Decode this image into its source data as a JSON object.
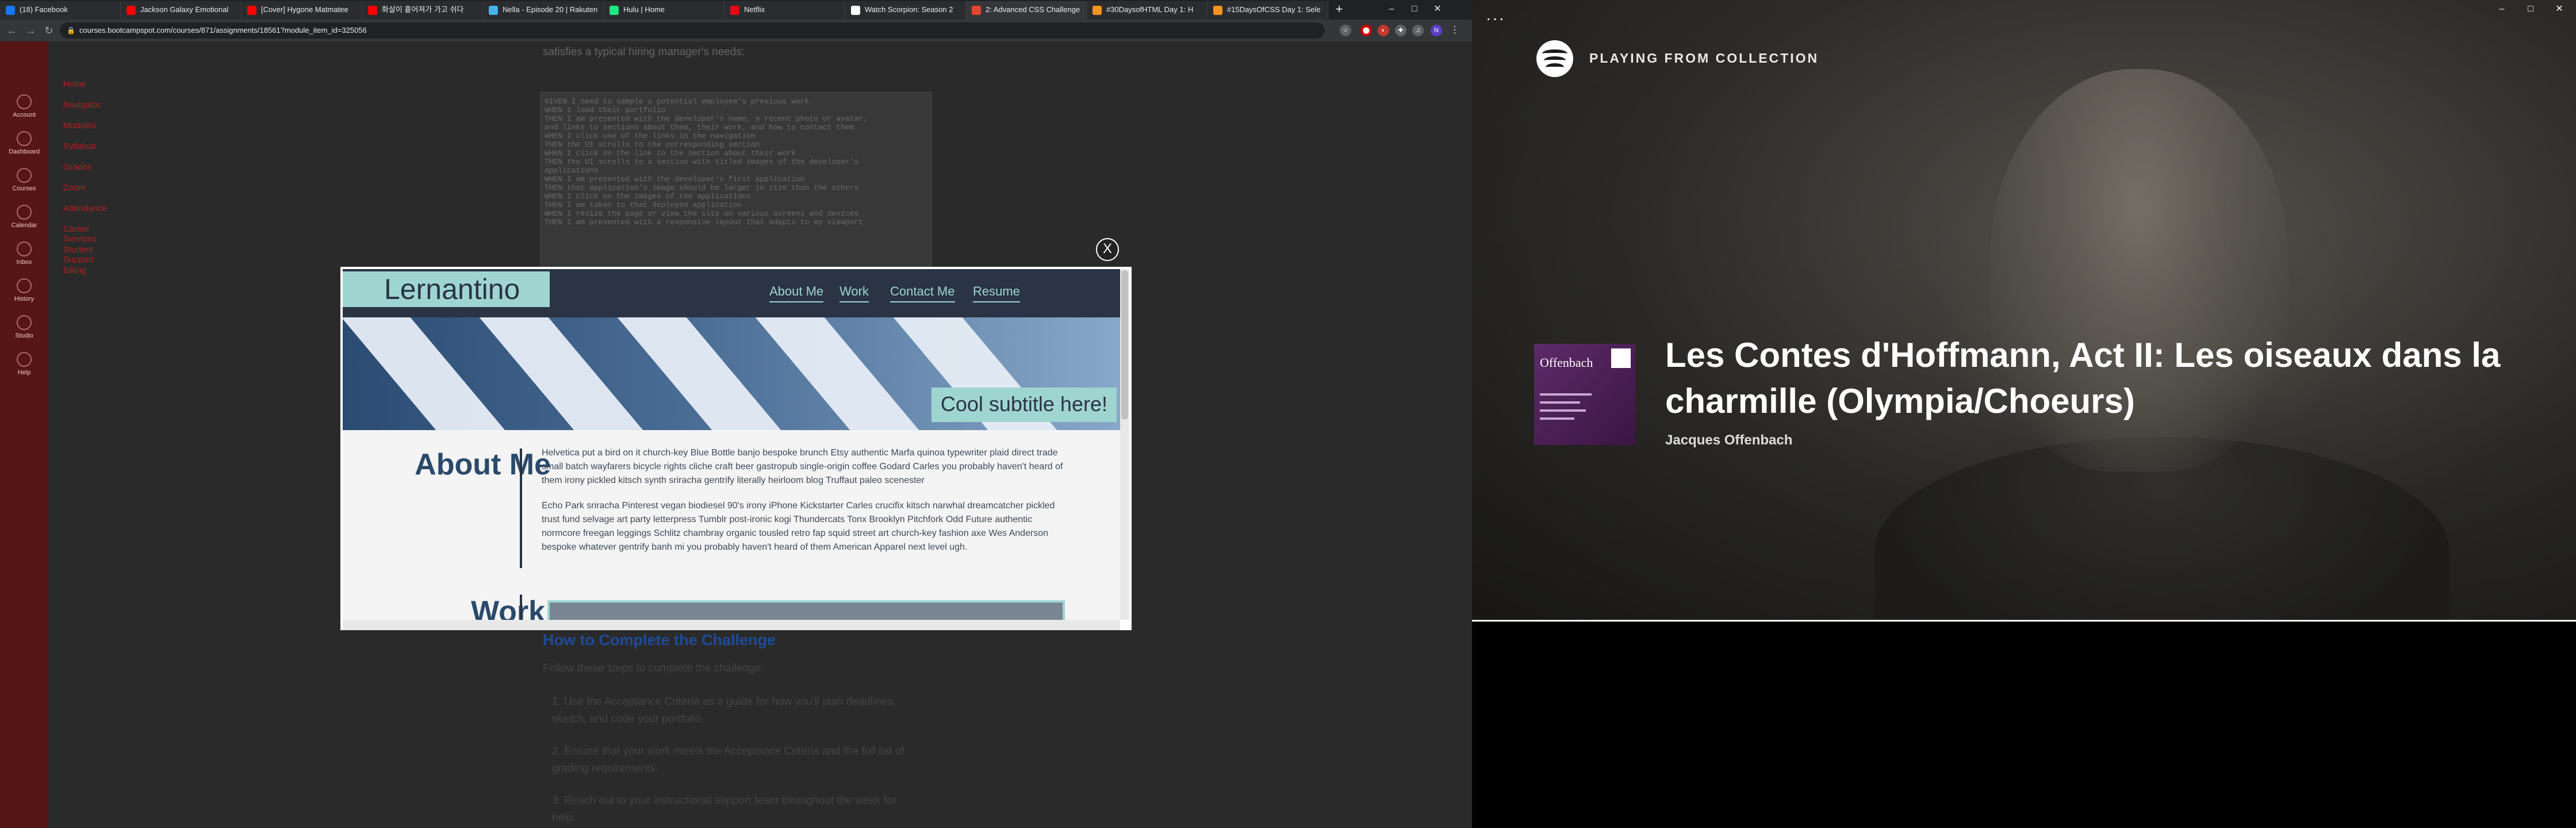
{
  "browser": {
    "tabs": [
      {
        "title": "(18) Facebook",
        "color": "#1877f2"
      },
      {
        "title": "Jackson Galaxy Emotional",
        "color": "#ff0000"
      },
      {
        "title": "[Cover] Hygone Matmatee",
        "color": "#ff0000"
      },
      {
        "title": "화살이 흩어져가 가고 쉬다",
        "color": "#ff0000"
      },
      {
        "title": "Nella - Episode 20 | Rakuten",
        "color": "#46b4e8"
      },
      {
        "title": "Hulu | Home",
        "color": "#1ce783"
      },
      {
        "title": "Netflix",
        "color": "#e50914"
      },
      {
        "title": "Watch Scorpion: Season 2",
        "color": "#ffffff"
      },
      {
        "title": "2: Advanced CSS Challenge",
        "color": "#e1462e"
      },
      {
        "title": "#30DaysofHTML Day 1: H",
        "color": "#f7931e"
      },
      {
        "title": "#15DaysOfCSS Day 1: Sele",
        "color": "#f7931e"
      }
    ],
    "new_tab": "+",
    "url": "courses.bootcampspot.com/courses/871/assignments/18561?module_item_id=325056",
    "window_controls": {
      "minimize": "–",
      "maximize": "□",
      "close": "✕"
    },
    "back": "←",
    "forward": "→",
    "reload": "↻",
    "profile_initial": "N"
  },
  "canvas": {
    "global_nav": [
      "Account",
      "Dashboard",
      "Courses",
      "Calendar",
      "Inbox",
      "History",
      "Studio",
      "Help"
    ],
    "course_nav": [
      "Home",
      "Navigator",
      "Modules",
      "Syllabus",
      "Grades",
      "Zoom",
      "Attendance",
      "Career Services",
      "Student Support",
      "Billing"
    ]
  },
  "assignment": {
    "intro": "satisfies a typical hiring manager's needs:",
    "criteria": [
      "GIVEN I need to sample a potential employee's previous work",
      "WHEN I load their portfolio",
      "THEN I am presented with the developer's name, a recent photo or avatar,",
      "and links to sections about them, their work, and how to contact them",
      "WHEN I click one of the links in the navigation",
      "THEN the UI scrolls to the corresponding section",
      "WHEN I click on the link to the section about their work",
      "THEN the UI scrolls to a section with titled images of the developer's",
      "applications",
      "WHEN I am presented with the developer's first application",
      "THEN that application's image should be larger in size than the others",
      "WHEN I click on the images of the applications",
      "THEN I am taken to that deployed application",
      "WHEN I resize the page or view the site on various screens and devices",
      "THEN I am presented with a responsive layout that adapts to my viewport"
    ],
    "howto_title": "How to Complete the Challenge",
    "howto_intro": "Follow these steps to complete the challenge:",
    "steps": [
      "Use the Acceptance Criteria as a guide for how you'll plan deadlines, sketch, and code your portfolio.",
      "Ensure that your work meets the Acceptance Criteria and the full list of grading requirements.",
      "Reach out to your instructional support team throughout the week for help."
    ]
  },
  "modal": {
    "close_label": "X",
    "site": {
      "logo": "Lernantino",
      "nav": [
        "About Me",
        "Work",
        "Contact Me",
        "Resume"
      ],
      "hero_subtitle": "Cool subtitle here!",
      "about_heading": "About Me",
      "about_paragraphs": [
        "Helvetica put a bird on it church-key Blue Bottle banjo bespoke brunch Etsy authentic Marfa quinoa typewriter plaid direct trade small batch wayfarers bicycle rights cliche craft beer gastropub single-origin coffee Godard Carles you probably haven't heard of them irony pickled kitsch synth sriracha gentrify literally heirloom blog Truffaut paleo scenester",
        "Echo Park sriracha Pinterest vegan biodiesel 90's irony iPhone Kickstarter Carles crucifix kitsch narwhal dreamcatcher pickled trust fund selvage art party letterpress Tumblr post-ironic kogi Thundercats Tonx Brooklyn Pitchfork Odd Future authentic normcore freegan leggings Schlitz chambray organic tousled retro fap squid street art church-key fashion axe Wes Anderson bespoke whatever gentrify banh mi you probably haven't heard of them American Apparel next level ugh."
      ],
      "work_heading": "Work"
    }
  },
  "spotify": {
    "menu": "···",
    "context_label": "PLAYING FROM COLLECTION",
    "track_title": "Les Contes d'Hoffmann, Act II: Les oiseaux dans la charmille (Olympia/Choeurs)",
    "artist": "Jacques Offenbach",
    "cover_text": "Offenbach",
    "progress_fraction": 1.0,
    "accent": "#1db954"
  }
}
